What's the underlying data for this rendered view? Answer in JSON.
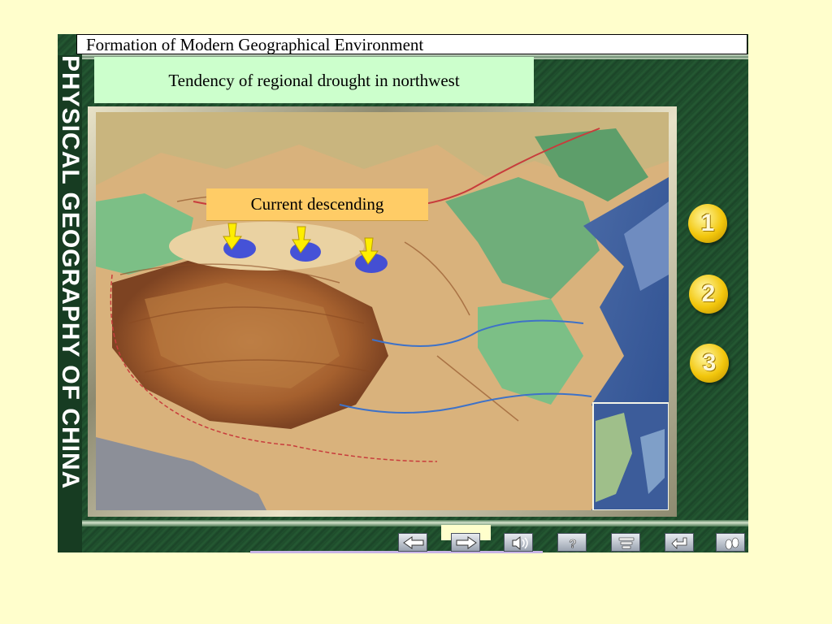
{
  "header": {
    "title": "Formation of Modern Geographical Environment"
  },
  "sidebar": {
    "title": "PHYSICAL GEOGRAPHY OF CHINA"
  },
  "slide": {
    "subtitle": "Tendency of regional drought in northwest"
  },
  "map": {
    "callout": "Current descending",
    "markers": [
      "blue-ellipse-marker",
      "blue-ellipse-marker",
      "blue-ellipse-marker"
    ]
  },
  "numbered_buttons": [
    "1",
    "2",
    "3"
  ],
  "toolbar": [
    {
      "icon": "back-arrow-icon"
    },
    {
      "icon": "forward-arrow-icon"
    },
    {
      "icon": "speaker-icon"
    },
    {
      "icon": "help-icon"
    },
    {
      "icon": "menu-icon"
    },
    {
      "icon": "return-icon"
    },
    {
      "icon": "footprint-icon"
    }
  ]
}
